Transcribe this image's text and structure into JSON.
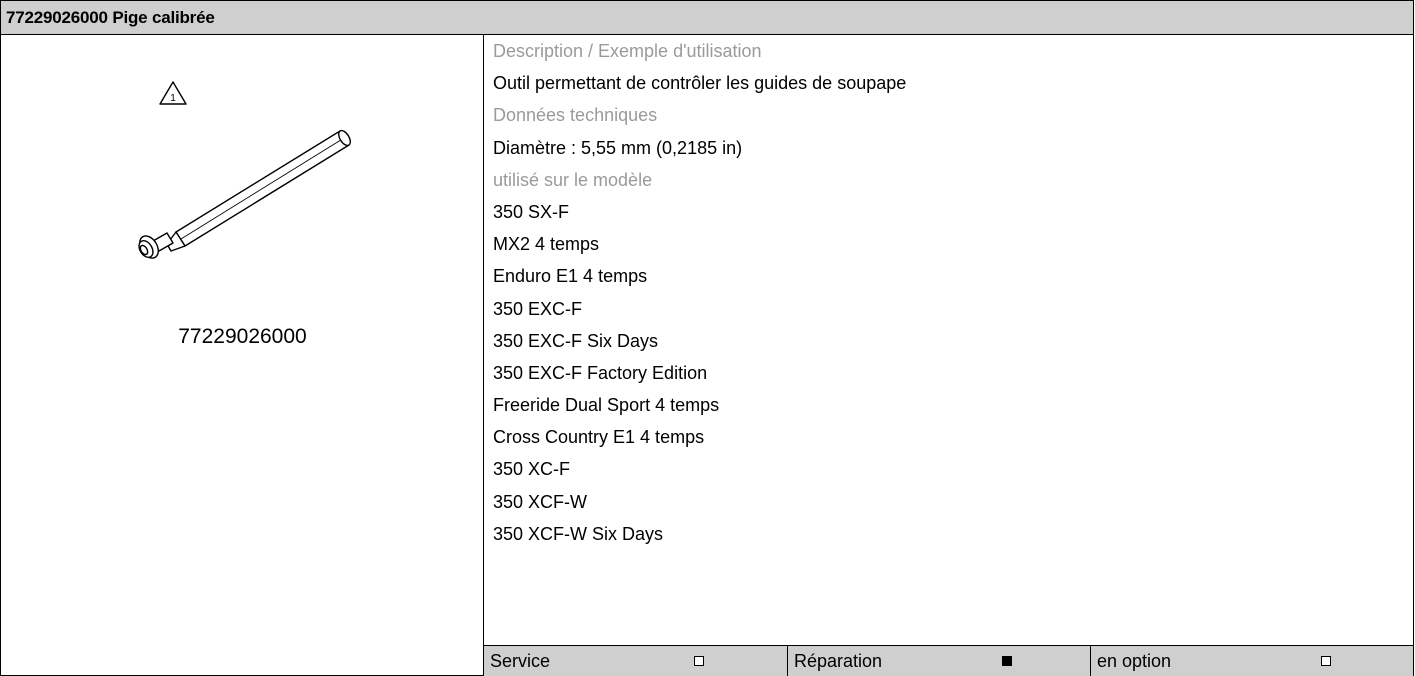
{
  "header": {
    "title": "77229026000 Pige calibrée"
  },
  "left": {
    "icon": "warning-triangle-1-icon",
    "image": "calibrated-pin-illustration",
    "part_number": "77229026000"
  },
  "rows": [
    {
      "kind": "head",
      "text": "Description / Exemple d'utilisation"
    },
    {
      "kind": "item",
      "text": "Outil permettant de contrôler les guides de soupape"
    },
    {
      "kind": "head",
      "text": "Données techniques"
    },
    {
      "kind": "item",
      "text": "Diamètre : 5,55 mm (0,2185 in)"
    },
    {
      "kind": "head",
      "text": "utilisé sur le modèle"
    },
    {
      "kind": "item",
      "text": "350 SX-F"
    },
    {
      "kind": "item",
      "text": "MX2 4 temps"
    },
    {
      "kind": "item",
      "text": "Enduro E1 4 temps"
    },
    {
      "kind": "item",
      "text": "350 EXC-F"
    },
    {
      "kind": "item",
      "text": "350 EXC-F Six Days"
    },
    {
      "kind": "item",
      "text": "350 EXC-F Factory Edition"
    },
    {
      "kind": "item",
      "text": "Freeride Dual Sport 4 temps"
    },
    {
      "kind": "item",
      "text": "Cross Country E1 4 temps"
    },
    {
      "kind": "item",
      "text": "350 XC-F"
    },
    {
      "kind": "item",
      "text": "350 XCF-W"
    },
    {
      "kind": "item",
      "text": "350 XCF-W Six Days"
    }
  ],
  "footer": [
    {
      "label": "Service",
      "checked": false
    },
    {
      "label": "Réparation",
      "checked": true
    },
    {
      "label": "en option",
      "checked": false
    }
  ]
}
